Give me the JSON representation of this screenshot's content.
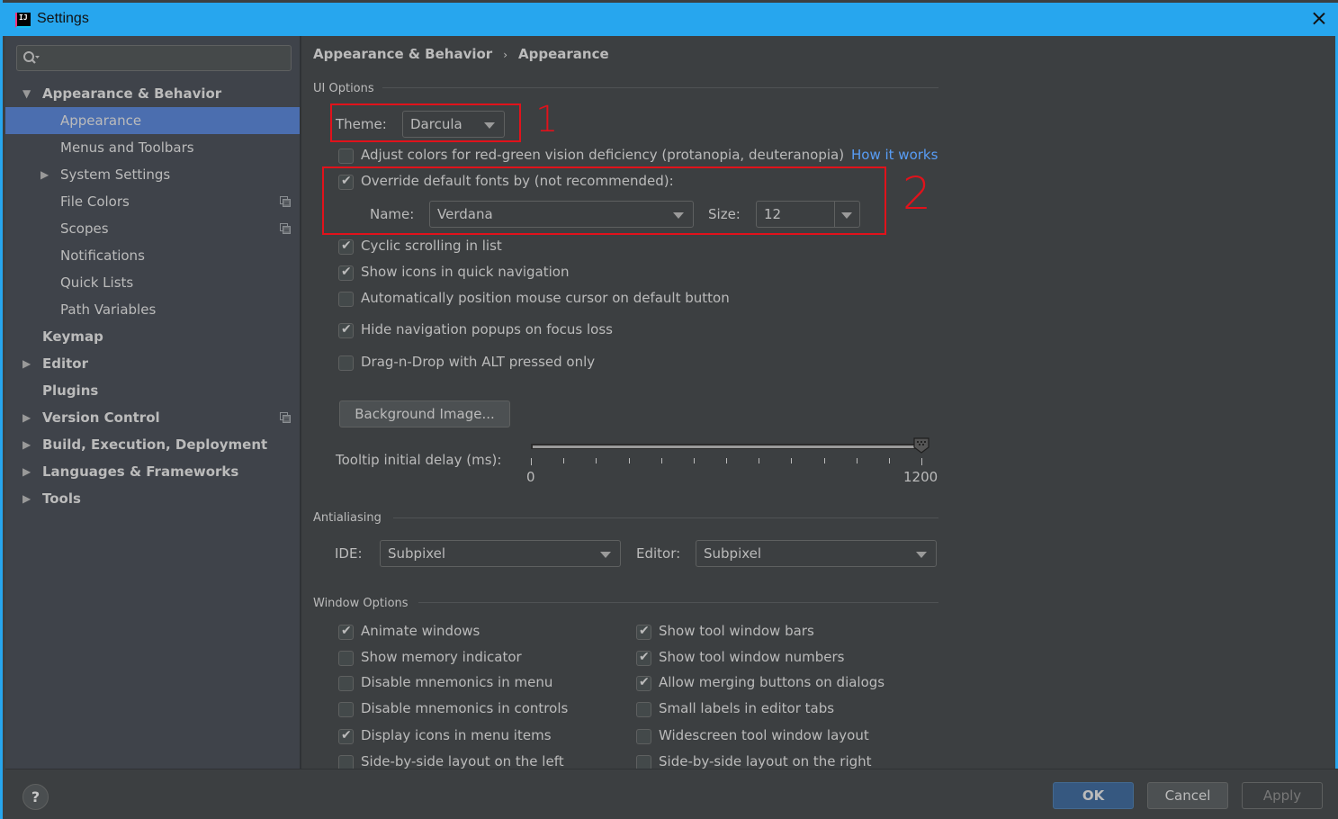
{
  "window": {
    "title": "Settings",
    "app_icon": "intellij-idea-icon"
  },
  "sidebar": {
    "search": {
      "value": "",
      "placeholder": ""
    },
    "items": [
      {
        "label": "Appearance & Behavior",
        "level": 0,
        "bold": true,
        "expandable": true,
        "expanded": true
      },
      {
        "label": "Appearance",
        "level": 1,
        "selected": true
      },
      {
        "label": "Menus and Toolbars",
        "level": 1
      },
      {
        "label": "System Settings",
        "level": 1,
        "expandable": true,
        "expanded": false
      },
      {
        "label": "File Colors",
        "level": 1,
        "project_icon": true
      },
      {
        "label": "Scopes",
        "level": 1,
        "project_icon": true
      },
      {
        "label": "Notifications",
        "level": 1
      },
      {
        "label": "Quick Lists",
        "level": 1
      },
      {
        "label": "Path Variables",
        "level": 1
      },
      {
        "label": "Keymap",
        "level": 0,
        "bold": true
      },
      {
        "label": "Editor",
        "level": 0,
        "bold": true,
        "expandable": true,
        "expanded": false
      },
      {
        "label": "Plugins",
        "level": 0,
        "bold": true
      },
      {
        "label": "Version Control",
        "level": 0,
        "bold": true,
        "expandable": true,
        "expanded": false,
        "project_icon": true
      },
      {
        "label": "Build, Execution, Deployment",
        "level": 0,
        "bold": true,
        "expandable": true,
        "expanded": false
      },
      {
        "label": "Languages & Frameworks",
        "level": 0,
        "bold": true,
        "expandable": true,
        "expanded": false
      },
      {
        "label": "Tools",
        "level": 0,
        "bold": true,
        "expandable": true,
        "expanded": false
      }
    ]
  },
  "breadcrumb": {
    "parent": "Appearance & Behavior",
    "separator": "›",
    "current": "Appearance"
  },
  "ui_options": {
    "title": "UI Options",
    "theme": {
      "label": "Theme:",
      "value": "Darcula"
    },
    "color_deficiency": {
      "label": "Adjust colors for red-green vision deficiency (protanopia, deuteranopia)",
      "checked": false,
      "link": "How it works"
    },
    "override_fonts": {
      "label": "Override default fonts by (not recommended):",
      "checked": true
    },
    "font_name": {
      "label": "Name:",
      "value": "Verdana"
    },
    "font_size": {
      "label": "Size:",
      "value": "12"
    },
    "checkboxes": [
      {
        "label": "Cyclic scrolling in list",
        "checked": true
      },
      {
        "label": "Show icons in quick navigation",
        "checked": true
      },
      {
        "label": "Automatically position mouse cursor on default button",
        "checked": false
      },
      {
        "label": "Hide navigation popups on focus loss",
        "checked": true
      },
      {
        "label": "Drag-n-Drop with ALT pressed only",
        "checked": false
      }
    ],
    "background_image_button": "Background Image...",
    "tooltip_delay": {
      "label": "Tooltip initial delay (ms):",
      "min": 0,
      "max": 1200,
      "value": 1200,
      "min_label": "0",
      "max_label": "1200",
      "tick_count": 13
    }
  },
  "annotations": {
    "box1_number": "1",
    "box2_number": "2",
    "color": "#e1121b"
  },
  "antialiasing": {
    "title": "Antialiasing",
    "ide": {
      "label": "IDE:",
      "value": "Subpixel"
    },
    "editor": {
      "label": "Editor:",
      "value": "Subpixel"
    }
  },
  "window_options": {
    "title": "Window Options",
    "left": [
      {
        "label": "Animate windows",
        "checked": true
      },
      {
        "label": "Show memory indicator",
        "checked": false
      },
      {
        "label": "Disable mnemonics in menu",
        "checked": false
      },
      {
        "label": "Disable mnemonics in controls",
        "checked": false
      },
      {
        "label": "Display icons in menu items",
        "checked": true
      },
      {
        "label": "Side-by-side layout on the left",
        "checked": false
      }
    ],
    "right": [
      {
        "label": "Show tool window bars",
        "checked": true
      },
      {
        "label": "Show tool window numbers",
        "checked": true
      },
      {
        "label": "Allow merging buttons on dialogs",
        "checked": true
      },
      {
        "label": "Small labels in editor tabs",
        "checked": false
      },
      {
        "label": "Widescreen tool window layout",
        "checked": false
      },
      {
        "label": "Side-by-side layout on the right",
        "checked": false
      }
    ]
  },
  "footer": {
    "help": "?",
    "ok": "OK",
    "cancel": "Cancel",
    "apply": "Apply"
  },
  "colors": {
    "titlebar": "#27a6ee",
    "selection": "#4b6eaf",
    "link": "#589df6",
    "ok_button": "#365880"
  }
}
